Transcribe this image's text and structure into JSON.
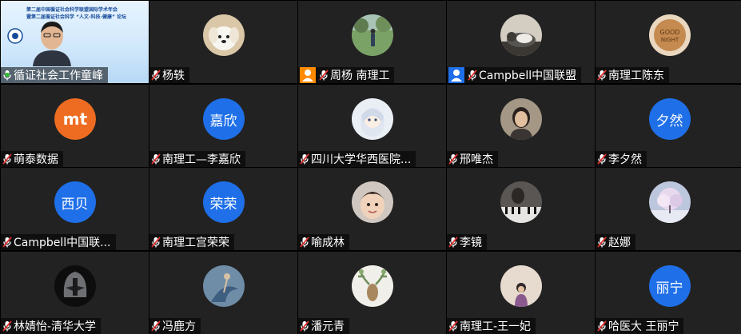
{
  "meeting": {
    "participants": [
      {
        "name": "循证社会工作童峰",
        "avatar_text": "",
        "kind": "video",
        "speaking": true,
        "mic": "green"
      },
      {
        "name": "杨轶",
        "avatar_text": "",
        "kind": "photo-dog",
        "mic": "muted"
      },
      {
        "name": "周杨 南理工",
        "avatar_text": "",
        "kind": "photo-field",
        "mic": "muted",
        "user_icon": "orange"
      },
      {
        "name": "Campbell中国联盟",
        "avatar_text": "",
        "kind": "photo-cat",
        "mic": "muted",
        "user_icon": "blue"
      },
      {
        "name": "南理工陈东",
        "avatar_text": "",
        "kind": "photo-cookie",
        "mic": "muted"
      },
      {
        "name": "萌泰数据",
        "avatar_text": "mt",
        "kind": "logo-orange",
        "mic": "muted"
      },
      {
        "name": "南理工—李嘉欣",
        "avatar_text": "嘉欣",
        "kind": "text",
        "mic": "muted"
      },
      {
        "name": "四川大学华西医院...",
        "avatar_text": "",
        "kind": "photo-anime",
        "mic": "muted"
      },
      {
        "name": "邢唯杰",
        "avatar_text": "",
        "kind": "photo-woman",
        "mic": "muted"
      },
      {
        "name": "李夕然",
        "avatar_text": "夕然",
        "kind": "text",
        "mic": "muted"
      },
      {
        "name": "Campbell中国联...",
        "avatar_text": "西贝",
        "kind": "text",
        "mic": "muted"
      },
      {
        "name": "南理工宫荣荣",
        "avatar_text": "荣荣",
        "kind": "text",
        "mic": "muted"
      },
      {
        "name": "喻成林",
        "avatar_text": "",
        "kind": "photo-child",
        "mic": "muted"
      },
      {
        "name": "李镜",
        "avatar_text": "",
        "kind": "photo-piano",
        "mic": "muted"
      },
      {
        "name": "赵娜",
        "avatar_text": "",
        "kind": "photo-tree",
        "mic": "muted"
      },
      {
        "name": "林婧怡-清华大学",
        "avatar_text": "",
        "kind": "photo-helmet",
        "mic": "muted"
      },
      {
        "name": "冯鹿方",
        "avatar_text": "",
        "kind": "photo-dancer",
        "mic": "muted"
      },
      {
        "name": "潘元青",
        "avatar_text": "",
        "kind": "photo-deer",
        "mic": "muted"
      },
      {
        "name": "南理工-王一妃",
        "avatar_text": "",
        "kind": "photo-girl",
        "mic": "muted"
      },
      {
        "name": "哈医大 王丽宁",
        "avatar_text": "丽宁",
        "kind": "text",
        "mic": "muted"
      }
    ]
  },
  "slide": {
    "line1": "第二届中国循证社会科学联盟国际学术年会",
    "line2": "暨第二届循证社会科学 “人文-科技-健康” 论坛"
  },
  "colors": {
    "tile_bg": "#222222",
    "avatar_blue": "#1e6fe8",
    "mic_muted": "#e0312f",
    "mic_live": "#2fbf2f"
  }
}
